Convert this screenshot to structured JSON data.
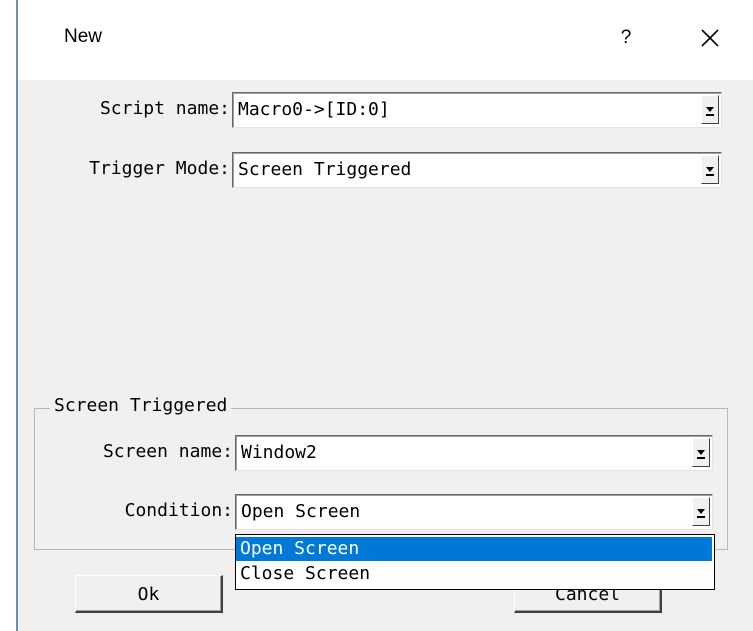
{
  "window": {
    "title": "New",
    "help_label": "?"
  },
  "fields": {
    "script_name": {
      "label": "Script name:",
      "value": "Macro0->[ID:0]"
    },
    "trigger_mode": {
      "label": "Trigger Mode:",
      "value": "Screen Triggered"
    }
  },
  "group": {
    "title": "Screen Triggered",
    "screen_name": {
      "label": "Screen name:",
      "value": "Window2"
    },
    "condition": {
      "label": "Condition:",
      "value": "Open Screen",
      "options": [
        "Open Screen",
        "Close Screen"
      ],
      "highlighted_option": "Open Screen"
    }
  },
  "buttons": {
    "ok": "Ok",
    "cancel": "Cancel"
  },
  "colors": {
    "selection": "#0078d7",
    "dialog_bg": "#f0f0f0"
  },
  "icons": {
    "close": "close-icon",
    "dropdown": "chevron-down-icon"
  }
}
